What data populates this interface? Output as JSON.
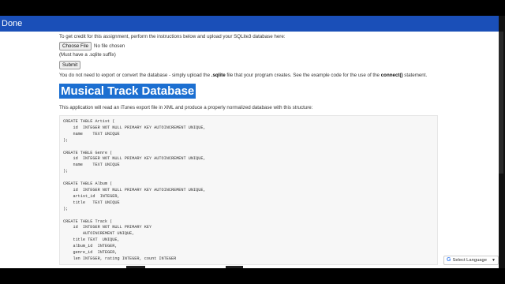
{
  "header": {
    "done_label": "Done"
  },
  "page": {
    "intro_text": "To get credit for this assignment, perform the instructions below and upload your SQLite3 database here:",
    "choose_file_label": "Choose File",
    "no_file_text": "No file chosen",
    "suffix_note": "(Must have a .sqlite suffix)",
    "submit_label": "Submit",
    "note_part1": "You do not need to export or convert the database - simply upload the ",
    "note_bold1": ".sqlite",
    "note_part2": " file that your program creates. See the example code for the use of the ",
    "note_bold2": "connect()",
    "note_part3": " statement.",
    "heading": "Musical Track Database",
    "description": "This application will read an iTunes export file in XML and produce a properly normalized database with this structure:",
    "code": "CREATE TABLE Artist (\n    id  INTEGER NOT NULL PRIMARY KEY AUTOINCREMENT UNIQUE,\n    name    TEXT UNIQUE\n);\n\nCREATE TABLE Genre (\n    id  INTEGER NOT NULL PRIMARY KEY AUTOINCREMENT UNIQUE,\n    name    TEXT UNIQUE\n);\n\nCREATE TABLE Album (\n    id  INTEGER NOT NULL PRIMARY KEY AUTOINCREMENT UNIQUE,\n    artist_id  INTEGER,\n    title   TEXT UNIQUE\n);\n\nCREATE TABLE Track (\n    id  INTEGER NOT NULL PRIMARY KEY\n        AUTOINCREMENT UNIQUE,\n    title TEXT  UNIQUE,\n    album_id  INTEGER,\n    genre_id  INTEGER,\n    len INTEGER, rating INTEGER, count INTEGER"
  },
  "translate": {
    "label": "Select Language",
    "icon": "google-g-icon"
  }
}
